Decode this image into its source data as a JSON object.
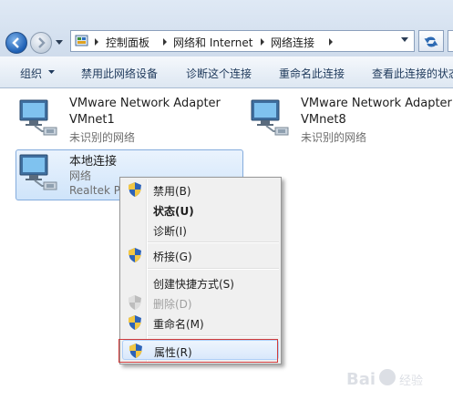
{
  "breadcrumb": {
    "items": [
      "控制面板",
      "网络和 Internet",
      "网络连接"
    ]
  },
  "toolbar": {
    "organize": "组织",
    "disable": "禁用此网络设备",
    "diagnose": "诊断这个连接",
    "rename": "重命名此连接",
    "view_status": "查看此连接的状态"
  },
  "adapters": [
    {
      "name": "VMware Network Adapter",
      "name2": "VMnet1",
      "status": "未识别的网络"
    },
    {
      "name": "VMware Network Adapter",
      "name2": "VMnet8",
      "status": "未识别的网络"
    },
    {
      "name": "本地连接",
      "status": "网络",
      "device": "Realtek PCIe"
    }
  ],
  "context_menu": {
    "items": [
      {
        "label": "禁用(B)",
        "shield": true
      },
      {
        "label": "状态(U)",
        "bold": true
      },
      {
        "label": "诊断(I)"
      },
      {
        "label": "桥接(G)",
        "shield": true
      },
      {
        "label": "创建快捷方式(S)"
      },
      {
        "label": "删除(D)",
        "shield": true,
        "disabled": true
      },
      {
        "label": "重命名(M)",
        "shield": true
      },
      {
        "label": "属性(R)",
        "shield": true,
        "highlighted": true
      }
    ]
  },
  "watermark": "Bai 经验",
  "colors": {
    "accent": "#1d5fb4",
    "highlight_border": "#d23b3b",
    "selection": "#cfe4fa"
  }
}
